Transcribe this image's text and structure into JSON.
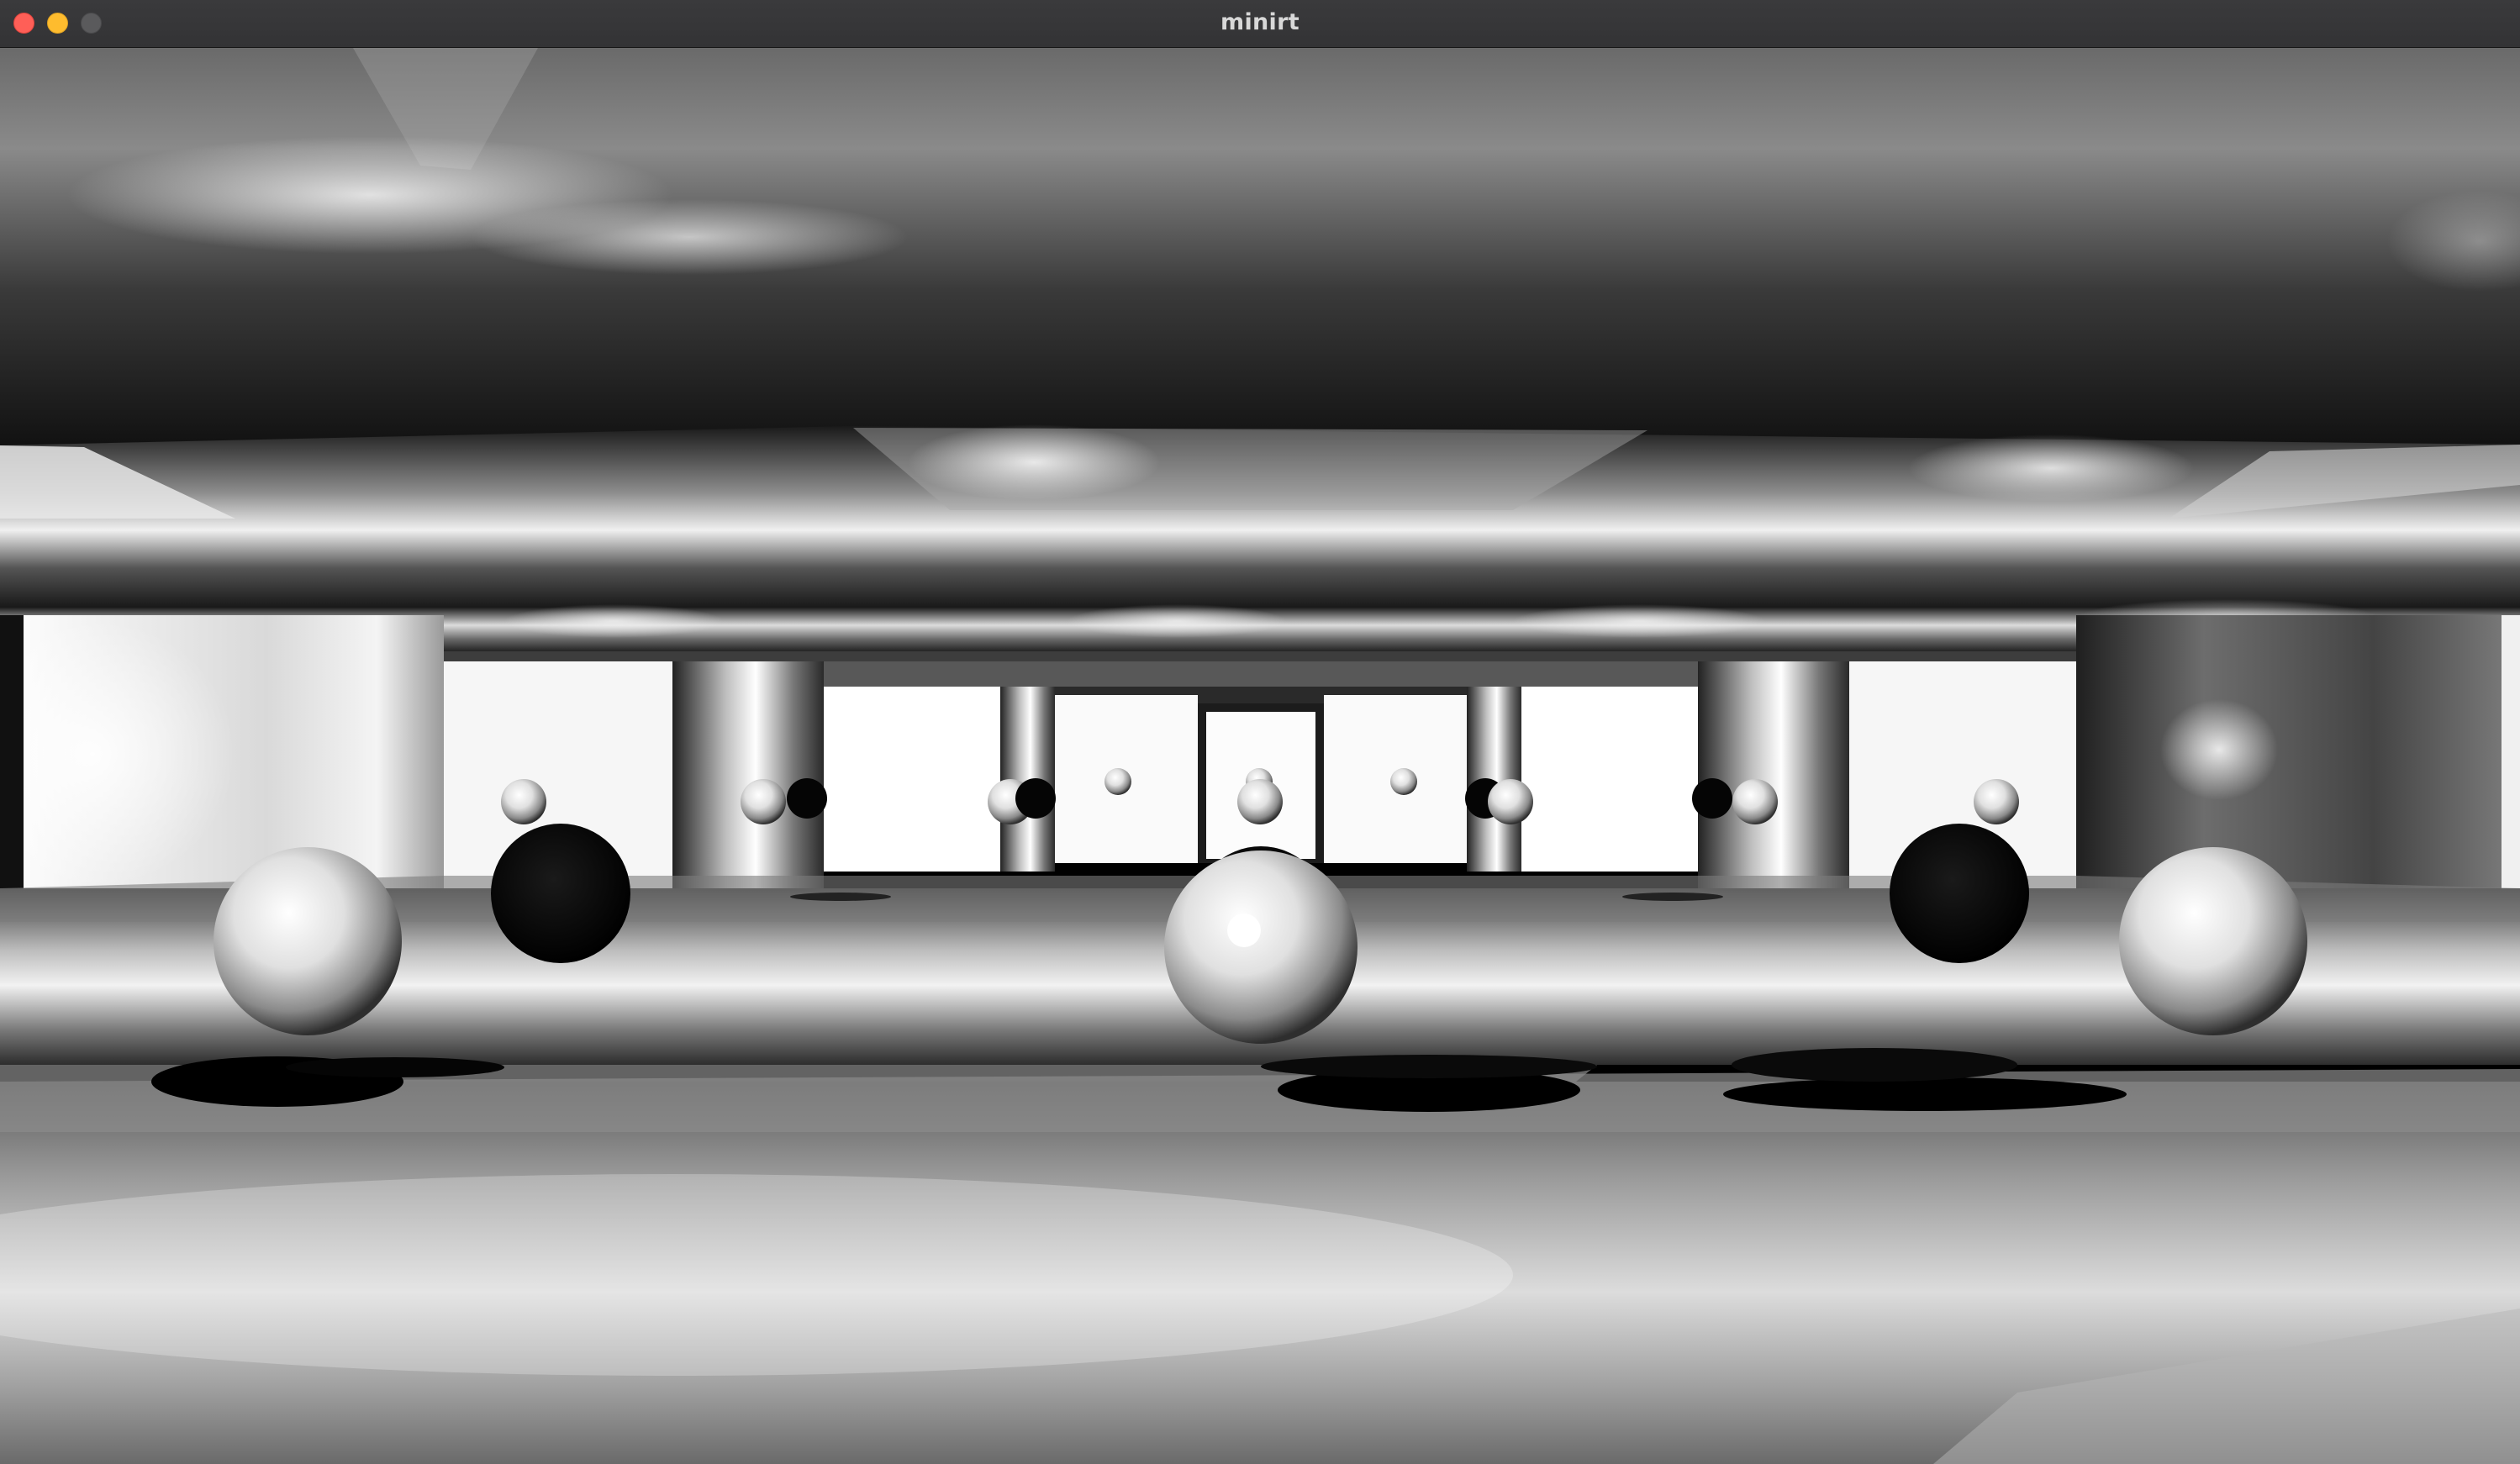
{
  "window": {
    "title": "minirt",
    "buttons": {
      "close": "close-button",
      "minimize": "minimize-button",
      "zoom": "zoom-button"
    }
  },
  "scene": {
    "description_icon": "raytraced-render",
    "colors": {
      "titlebar": "#3a3a3c",
      "close": "#ff5f57",
      "minimize": "#febc2e",
      "zoom": "#5a5a5c"
    }
  }
}
